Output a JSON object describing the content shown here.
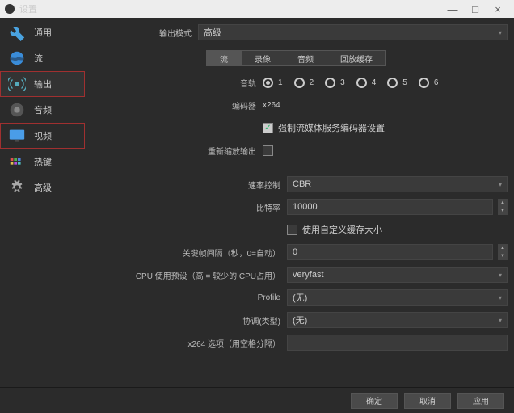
{
  "window": {
    "title": "设置",
    "min": "—",
    "max": "□",
    "close": "×"
  },
  "sidebar": {
    "items": [
      {
        "label": "通用"
      },
      {
        "label": "流"
      },
      {
        "label": "输出"
      },
      {
        "label": "音频"
      },
      {
        "label": "视频"
      },
      {
        "label": "热键"
      },
      {
        "label": "高级"
      }
    ]
  },
  "output_mode": {
    "label": "输出模式",
    "value": "高级"
  },
  "tabs": [
    "流",
    "录像",
    "音频",
    "回放缓存"
  ],
  "tracks": {
    "label": "音轨",
    "options": [
      "1",
      "2",
      "3",
      "4",
      "5",
      "6"
    ],
    "selected": 0
  },
  "encoder": {
    "label": "编码器",
    "value": "x264"
  },
  "enforce": {
    "text": "强制流媒体服务编码器设置",
    "checked": true
  },
  "rescale": {
    "label": "重新缩放输出",
    "checked": false
  },
  "rate_control": {
    "label": "速率控制",
    "value": "CBR"
  },
  "bitrate": {
    "label": "比特率",
    "value": "10000"
  },
  "custom_buffer": {
    "text": "使用自定义缓存大小",
    "checked": false
  },
  "keyframe": {
    "label": "关键帧间隔（秒，0=自动）",
    "value": "0"
  },
  "cpu_preset": {
    "label": "CPU 使用预设（高 = 较少的 CPU占用）",
    "value": "veryfast"
  },
  "profile": {
    "label": "Profile",
    "value": "(无)"
  },
  "tune": {
    "label": "协调(类型)",
    "value": "(无)"
  },
  "x264opts": {
    "label": "x264 选项（用空格分隔）",
    "value": ""
  },
  "footer": {
    "ok": "确定",
    "cancel": "取消",
    "apply": "应用"
  }
}
